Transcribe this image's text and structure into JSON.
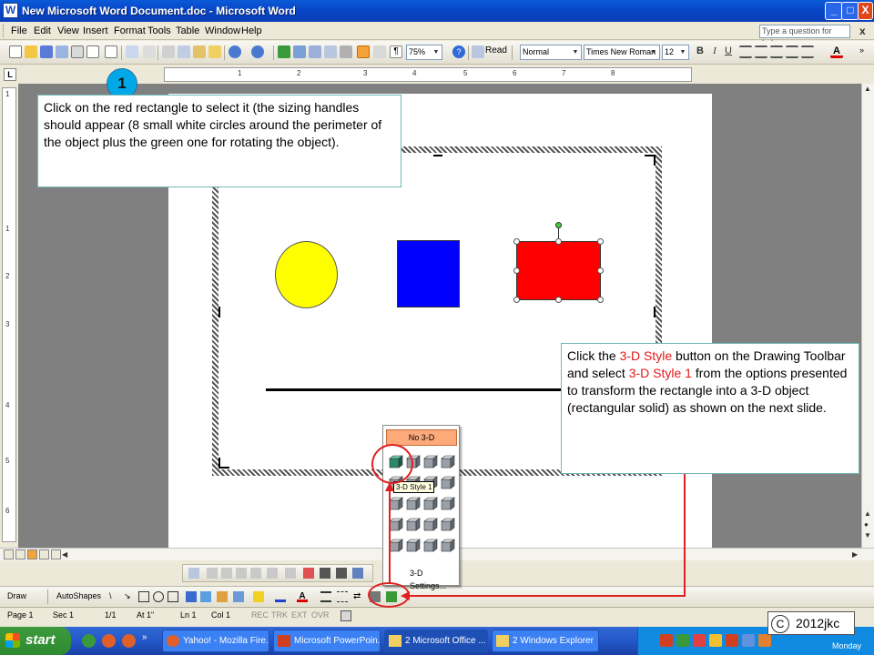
{
  "window": {
    "title": "New Microsoft Word Document.doc - Microsoft Word",
    "app_icon": "W",
    "controls": [
      "_",
      "□",
      "X"
    ]
  },
  "menu": {
    "items": [
      "File",
      "Edit",
      "View",
      "Insert",
      "Format",
      "Tools",
      "Table",
      "Window",
      "Help"
    ],
    "help_placeholder": "Type a question for help",
    "close_doc": "x"
  },
  "toolbar": {
    "zoom": "75%",
    "read_label": "Read",
    "style": "Normal",
    "font": "Times New Roman",
    "font_size": "12"
  },
  "ruler": {
    "tab_selector": "L",
    "numbers": [
      "1",
      "2",
      "3",
      "4",
      "5",
      "6",
      "7",
      "8"
    ],
    "v_numbers": [
      "1",
      "1",
      "2",
      "3",
      "4",
      "5",
      "6"
    ]
  },
  "three_d_menu": {
    "no_3d": "No 3-D",
    "tooltip": "3-D Style 1",
    "settings": "3-D Settings..."
  },
  "draw_toolbar": {
    "draw": "Draw",
    "autoshapes": "AutoShapes"
  },
  "statusbar": {
    "page": "Page 1",
    "sec": "Sec 1",
    "pages": "1/1",
    "at": "At 1\"",
    "ln": "Ln 1",
    "col": "Col 1",
    "rec": "REC",
    "trk": "TRK",
    "ext": "EXT",
    "ovr": "OVR"
  },
  "taskbar": {
    "start": "start",
    "tasks": [
      "Yahoo! - Mozilla Fire...",
      "Microsoft PowerPoin...",
      "2 Microsoft Office ...",
      "2 Windows Explorer"
    ],
    "day": "Monday"
  },
  "overlay": {
    "step_number": "1",
    "note1": "Click on the red rectangle to select it (the sizing handles should appear (8 small white circles around the perimeter of the object plus the green one for rotating the object).",
    "note2": {
      "p1": "Click the ",
      "h1": "3-D Style",
      "p2": " button on the Drawing Toolbar and select ",
      "h2": "3-D Style 1",
      "p3": " from the options presented to transform the rectangle into a 3-D object (rectangular solid) as shown on the next slide."
    },
    "copyright_symbol": "C",
    "copyright_text": "2012jkc"
  },
  "colors": {
    "shape_circle": "#ffff00",
    "shape_square": "#0000ff",
    "shape_rect": "#ff0000",
    "highlight": "#e21a1a",
    "badge": "#00a8e8"
  }
}
